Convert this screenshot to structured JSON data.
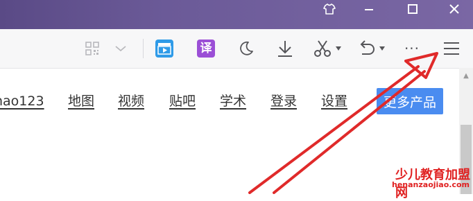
{
  "window": {
    "controls": [
      "skin-icon",
      "minimize-icon",
      "maximize-icon",
      "close-icon"
    ]
  },
  "toolbar": {
    "icons": [
      "qr-code-icon",
      "chevron-down-icon",
      "video-icon",
      "translate-icon",
      "moon-icon",
      "download-icon",
      "scissors-icon",
      "undo-icon",
      "more-icon",
      "menu-icon"
    ],
    "translate_glyph": "译",
    "more_glyph": "···",
    "colors": {
      "video": "#2f9be8",
      "translate": "#9b4fd6"
    }
  },
  "nav": {
    "links": [
      "hao123",
      "地图",
      "视频",
      "贴吧",
      "学术",
      "登录",
      "设置"
    ],
    "more_products": "更多产品",
    "more_color": "#4a8cf0"
  },
  "annotation": {
    "arrow_color": "#e02a2a"
  },
  "watermark": {
    "text": "少儿教育加盟网",
    "url": "henanzaojiao.com"
  }
}
